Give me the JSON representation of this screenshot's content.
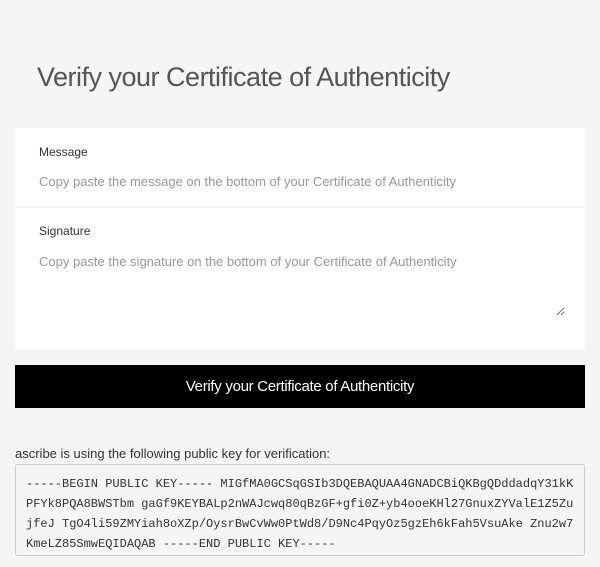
{
  "page": {
    "title": "Verify your Certificate of Authenticity"
  },
  "form": {
    "message": {
      "label": "Message",
      "placeholder": "Copy paste the message on the bottom of your Certificate of Authenticity",
      "value": ""
    },
    "signature": {
      "label": "Signature",
      "placeholder": "Copy paste the signature on the bottom of your Certificate of Authenticity",
      "value": ""
    },
    "submit_label": "Verify your Certificate of Authenticity"
  },
  "public_key": {
    "intro": "ascribe is using the following public key for verification:",
    "key_text": "-----BEGIN PUBLIC KEY----- MIGfMA0GCSqGSIb3DQEBAQUAA4GNADCBiQKBgQDddadqY31kKPFYk8PQA8BWSTbm gaGf9KEYBALp2nWAJcwq80qBzGF+gfi0Z+yb4ooeKHl27GnuxZYValE1Z5ZujfeJ TgO4li59ZMYiah8oXZp/OysrBwCvWw0PtWd8/D9Nc4PqyOz5gzEh6kFah5VsuAke Znu2w7KmeLZ85SmwEQIDAQAB -----END PUBLIC KEY-----"
  }
}
